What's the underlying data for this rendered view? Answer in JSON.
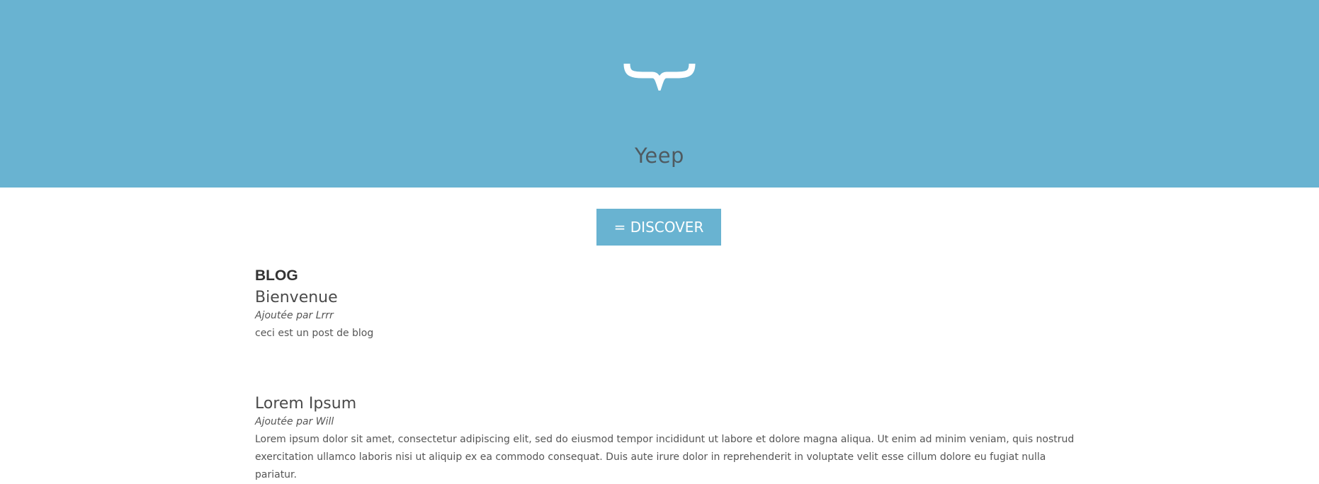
{
  "header": {
    "site_title": "Yeep",
    "logo_icon": "curly-brace-icon",
    "background_color": "#69b3d1"
  },
  "discover_button": {
    "label": "= DISCOVER"
  },
  "blog": {
    "heading": "BLOG",
    "posts": [
      {
        "title": "Bienvenue",
        "author": "Ajoutée par Lrrr",
        "body": "ceci est un post de blog"
      },
      {
        "title": "Lorem Ipsum",
        "author": "Ajoutée par Will",
        "body": "Lorem ipsum dolor sit amet, consectetur adipiscing elit, sed do eiusmod tempor incididunt ut labore et dolore magna aliqua. Ut enim ad minim veniam, quis nostrud exercitation ullamco laboris nisi ut aliquip ex ea commodo consequat. Duis aute irure dolor in reprehenderit in voluptate velit esse cillum dolore eu fugiat nulla pariatur."
      }
    ]
  }
}
